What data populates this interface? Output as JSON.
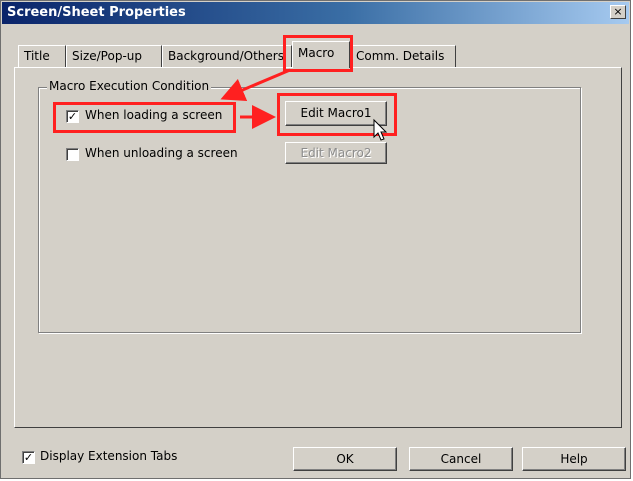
{
  "window": {
    "title": "Screen/Sheet Properties",
    "close_label": "×"
  },
  "tabs": [
    {
      "label": "Title",
      "active": false
    },
    {
      "label": "Size/Pop-up",
      "active": false
    },
    {
      "label": "Background/Others",
      "active": false
    },
    {
      "label": "Macro",
      "active": true
    },
    {
      "label": "Comm. Details",
      "active": false
    }
  ],
  "group": {
    "label": "Macro Execution Condition",
    "loading": {
      "label": "When loading a screen",
      "checked": true,
      "check_glyph": "✓",
      "button_label": "Edit Macro1",
      "button_enabled": true
    },
    "unloading": {
      "label": "When unloading a screen",
      "checked": false,
      "check_glyph": "",
      "button_label": "Edit Macro2",
      "button_enabled": false
    }
  },
  "footer": {
    "display_ext_label": "Display Extension Tabs",
    "display_ext_checked": true,
    "display_ext_glyph": "✓",
    "ok_label": "OK",
    "cancel_label": "Cancel",
    "help_label": "Help"
  },
  "colors": {
    "highlight": "#ff2020",
    "title_bar": "#0a246a",
    "dialog_bg": "#d4d0c8"
  }
}
